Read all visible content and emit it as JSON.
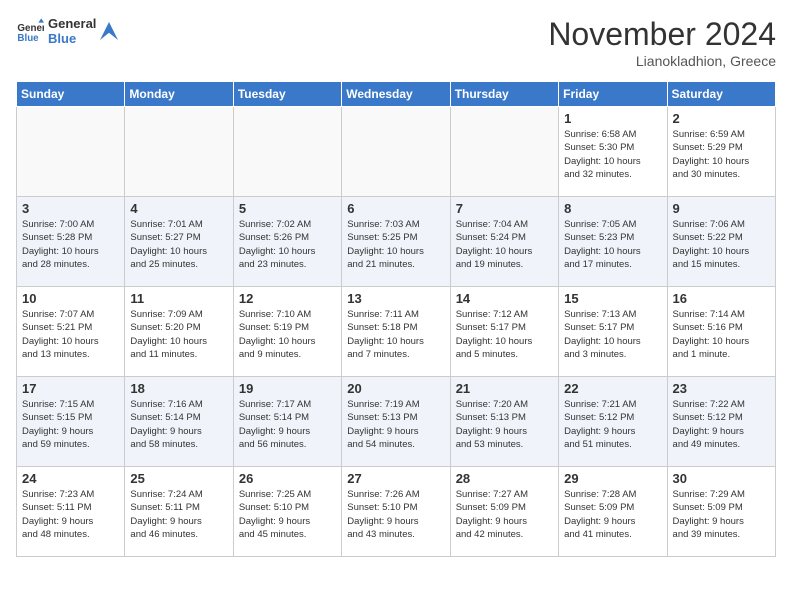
{
  "header": {
    "logo_line1": "General",
    "logo_line2": "Blue",
    "month": "November 2024",
    "location": "Lianokladhion, Greece"
  },
  "days_of_week": [
    "Sunday",
    "Monday",
    "Tuesday",
    "Wednesday",
    "Thursday",
    "Friday",
    "Saturday"
  ],
  "weeks": [
    [
      {
        "day": "",
        "info": ""
      },
      {
        "day": "",
        "info": ""
      },
      {
        "day": "",
        "info": ""
      },
      {
        "day": "",
        "info": ""
      },
      {
        "day": "",
        "info": ""
      },
      {
        "day": "1",
        "info": "Sunrise: 6:58 AM\nSunset: 5:30 PM\nDaylight: 10 hours\nand 32 minutes."
      },
      {
        "day": "2",
        "info": "Sunrise: 6:59 AM\nSunset: 5:29 PM\nDaylight: 10 hours\nand 30 minutes."
      }
    ],
    [
      {
        "day": "3",
        "info": "Sunrise: 7:00 AM\nSunset: 5:28 PM\nDaylight: 10 hours\nand 28 minutes."
      },
      {
        "day": "4",
        "info": "Sunrise: 7:01 AM\nSunset: 5:27 PM\nDaylight: 10 hours\nand 25 minutes."
      },
      {
        "day": "5",
        "info": "Sunrise: 7:02 AM\nSunset: 5:26 PM\nDaylight: 10 hours\nand 23 minutes."
      },
      {
        "day": "6",
        "info": "Sunrise: 7:03 AM\nSunset: 5:25 PM\nDaylight: 10 hours\nand 21 minutes."
      },
      {
        "day": "7",
        "info": "Sunrise: 7:04 AM\nSunset: 5:24 PM\nDaylight: 10 hours\nand 19 minutes."
      },
      {
        "day": "8",
        "info": "Sunrise: 7:05 AM\nSunset: 5:23 PM\nDaylight: 10 hours\nand 17 minutes."
      },
      {
        "day": "9",
        "info": "Sunrise: 7:06 AM\nSunset: 5:22 PM\nDaylight: 10 hours\nand 15 minutes."
      }
    ],
    [
      {
        "day": "10",
        "info": "Sunrise: 7:07 AM\nSunset: 5:21 PM\nDaylight: 10 hours\nand 13 minutes."
      },
      {
        "day": "11",
        "info": "Sunrise: 7:09 AM\nSunset: 5:20 PM\nDaylight: 10 hours\nand 11 minutes."
      },
      {
        "day": "12",
        "info": "Sunrise: 7:10 AM\nSunset: 5:19 PM\nDaylight: 10 hours\nand 9 minutes."
      },
      {
        "day": "13",
        "info": "Sunrise: 7:11 AM\nSunset: 5:18 PM\nDaylight: 10 hours\nand 7 minutes."
      },
      {
        "day": "14",
        "info": "Sunrise: 7:12 AM\nSunset: 5:17 PM\nDaylight: 10 hours\nand 5 minutes."
      },
      {
        "day": "15",
        "info": "Sunrise: 7:13 AM\nSunset: 5:17 PM\nDaylight: 10 hours\nand 3 minutes."
      },
      {
        "day": "16",
        "info": "Sunrise: 7:14 AM\nSunset: 5:16 PM\nDaylight: 10 hours\nand 1 minute."
      }
    ],
    [
      {
        "day": "17",
        "info": "Sunrise: 7:15 AM\nSunset: 5:15 PM\nDaylight: 9 hours\nand 59 minutes."
      },
      {
        "day": "18",
        "info": "Sunrise: 7:16 AM\nSunset: 5:14 PM\nDaylight: 9 hours\nand 58 minutes."
      },
      {
        "day": "19",
        "info": "Sunrise: 7:17 AM\nSunset: 5:14 PM\nDaylight: 9 hours\nand 56 minutes."
      },
      {
        "day": "20",
        "info": "Sunrise: 7:19 AM\nSunset: 5:13 PM\nDaylight: 9 hours\nand 54 minutes."
      },
      {
        "day": "21",
        "info": "Sunrise: 7:20 AM\nSunset: 5:13 PM\nDaylight: 9 hours\nand 53 minutes."
      },
      {
        "day": "22",
        "info": "Sunrise: 7:21 AM\nSunset: 5:12 PM\nDaylight: 9 hours\nand 51 minutes."
      },
      {
        "day": "23",
        "info": "Sunrise: 7:22 AM\nSunset: 5:12 PM\nDaylight: 9 hours\nand 49 minutes."
      }
    ],
    [
      {
        "day": "24",
        "info": "Sunrise: 7:23 AM\nSunset: 5:11 PM\nDaylight: 9 hours\nand 48 minutes."
      },
      {
        "day": "25",
        "info": "Sunrise: 7:24 AM\nSunset: 5:11 PM\nDaylight: 9 hours\nand 46 minutes."
      },
      {
        "day": "26",
        "info": "Sunrise: 7:25 AM\nSunset: 5:10 PM\nDaylight: 9 hours\nand 45 minutes."
      },
      {
        "day": "27",
        "info": "Sunrise: 7:26 AM\nSunset: 5:10 PM\nDaylight: 9 hours\nand 43 minutes."
      },
      {
        "day": "28",
        "info": "Sunrise: 7:27 AM\nSunset: 5:09 PM\nDaylight: 9 hours\nand 42 minutes."
      },
      {
        "day": "29",
        "info": "Sunrise: 7:28 AM\nSunset: 5:09 PM\nDaylight: 9 hours\nand 41 minutes."
      },
      {
        "day": "30",
        "info": "Sunrise: 7:29 AM\nSunset: 5:09 PM\nDaylight: 9 hours\nand 39 minutes."
      }
    ]
  ]
}
